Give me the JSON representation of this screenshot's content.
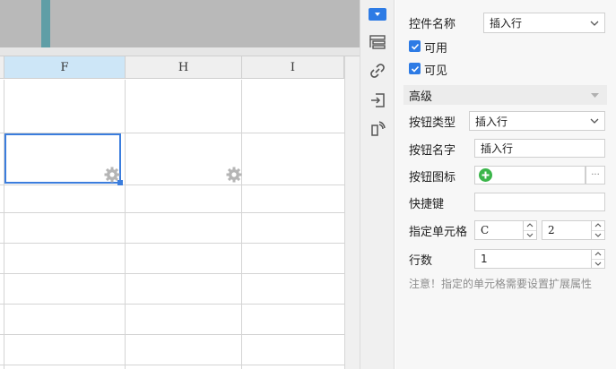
{
  "spreadsheet": {
    "columns": [
      "F",
      "H",
      "I"
    ],
    "selected_column": "F"
  },
  "properties": {
    "widget_name_label": "控件名称",
    "widget_name_value": "插入行",
    "enabled_label": "可用",
    "enabled_checked": true,
    "visible_label": "可见",
    "visible_checked": true,
    "advanced_section": "高级",
    "button_type_label": "按钮类型",
    "button_type_value": "插入行",
    "button_name_label": "按钮名字",
    "button_name_value": "插入行",
    "button_icon_label": "按钮图标",
    "button_icon_more": "···",
    "shortcut_label": "快捷键",
    "shortcut_value": "",
    "target_cell_label": "指定单元格",
    "target_cell_column": "C",
    "target_cell_row": "2",
    "row_count_label": "行数",
    "row_count_value": "1",
    "note": "注意！指定的单元格需要设置扩展属性"
  },
  "icons": {
    "rail": [
      "widget-settings-icon",
      "layout-icon",
      "link-icon",
      "import-icon",
      "event-icon"
    ],
    "accent": "#2d7be5",
    "add_icon_color": "#3bb54a"
  }
}
